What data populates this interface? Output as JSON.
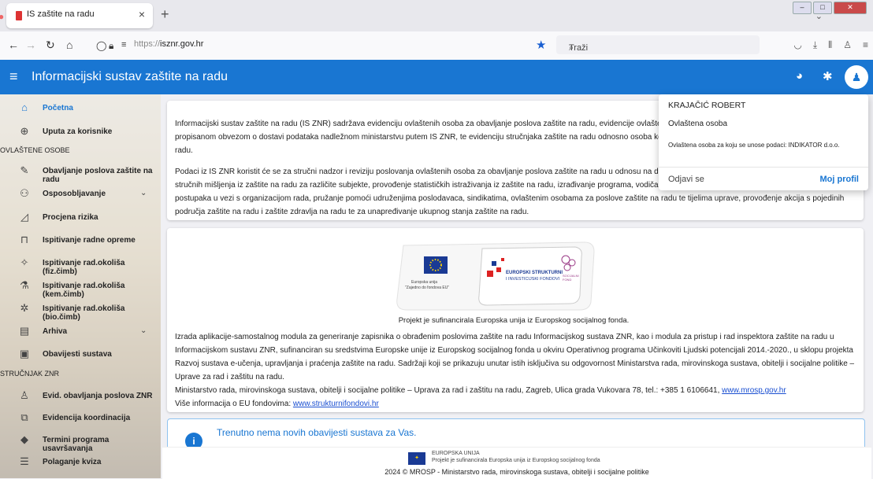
{
  "browser": {
    "tab_title": "IS zaštite na radu",
    "tab_close": "×",
    "new_tab": "+",
    "url_prefix": "https://",
    "url_domain": "isznr.gov.hr",
    "search_placeholder": "Traži"
  },
  "appbar": {
    "title": "Informacijski sustav zaštite na radu"
  },
  "sidebar": {
    "items": [
      {
        "label": "Početna"
      },
      {
        "label": "Uputa za korisnike"
      },
      {
        "label": "Obavljanje poslova zaštite na radu"
      },
      {
        "label": "Osposobljavanje"
      },
      {
        "label": "Procjena rizika"
      },
      {
        "label": "Ispitivanje radne opreme"
      },
      {
        "label": "Ispitivanje rad.okoliša (fiz.čimb)"
      },
      {
        "label": "Ispitivanje rad.okoliša (kem.čimb)"
      },
      {
        "label": "Ispitivanje rad.okoliša (bio.čimb)"
      },
      {
        "label": "Arhiva"
      },
      {
        "label": "Obavijesti sustava"
      },
      {
        "label": "Evid. obavljanja poslova ZNR"
      },
      {
        "label": "Evidencija koordinacija"
      },
      {
        "label": "Termini programa usavršavanja"
      },
      {
        "label": "Polaganje kviza"
      }
    ],
    "section_ovlastene": "OVLAŠTENE OSOBE",
    "section_strucnjak": "STRUČNJAK ZNR"
  },
  "intro": {
    "p1_l1": "Informacijski sustav zaštite na radu (IS ZNR) sadržava evidenciju ovlaštenih osoba za obavljanje poslova zaštite na radu, evidencije ovlašteni",
    "p1_l2": "propisanom obvezom o dostavi podataka nadležnom ministarstvu putem IS ZNR, te evidenciju stručnjaka zaštite na radu odnosno osoba koj",
    "p1_l3": "radu.",
    "p2_l1": "Podaci iz IS ZNR koristit će se za stručni nadzor i reviziju poslovanja ovlaštenih osoba za obavljanje poslova zaštite na radu u odnosu na dob",
    "p2_l2": "stručnih mišljenja iz zaštite na radu za različite subjekte, provođenje statističkih istraživanja iz zaštite na radu, izrađivanje programa, vodiča, r",
    "p2_l3": "postupaka u vezi s organizacijom rada, pružanje pomoći udruženjima poslodavaca, sindikatima, ovlaštenim osobama za poslove zaštite na radu te tijelima uprave, provođenje akcija s pojedinih",
    "p2_l4": "područja zaštite na radu i zaštite zdravlja na radu te za unapređivanje ukupnog stanja zaštite na radu."
  },
  "eu": {
    "logo_eu_l1": "Europska unija",
    "logo_eu_l2": "\"Zajedno do fondova EU\"",
    "logo_fondovi_l1": "EUROPSKI STRUKTURNI",
    "logo_fondovi_l2": "I INVESTICIJSKI FONDOVI",
    "logo_esf": "SOCIJALNI FOND",
    "caption": "Projekt je sufinancirala Europska unija iz Europskog socijalnog fonda.",
    "l1": "Izrada aplikacije-samostalnog modula za generiranje zapisnika o obrađenim poslovima zaštite na radu Informacijskog sustava ZNR, kao i modula za pristup i rad inspektora zaštite na radu u",
    "l2": "Informacijskom sustavu ZNR, sufinanciran su sredstvima Europske unije iz Europskog socijalnog fonda u okviru Operativnog programa Učinkoviti Ljudski potencijali 2014.-2020., u sklopu projekta",
    "l3": "Razvoj sustava e-učenja, upravljanja i praćenja zaštite na radu. Sadržaji koji se prikazuju unutar istih isključiva su odgovornost Ministarstva rada, mirovinskoga sustava, obitelji i socijalne politike –",
    "l4": "Uprave za rad i zaštitu na radu.",
    "l5": "Ministarstvo rada, mirovinskoga sustava, obitelji i socijalne politike – Uprava za rad i zaštitu na radu, Zagreb, Ulica grada Vukovara 78, tel.: +385 1 6106641, ",
    "l5_link": "www.mrosp.gov.hr",
    "l6": "Više informacija o EU fondovima: ",
    "l6_link": "www.strukturnifondovi.hr"
  },
  "notification": {
    "icon": "i",
    "text": "Trenutno nema novih obavijesti sustava za Vas."
  },
  "footer": {
    "eu": "EUROPSKA UNIJA",
    "sub": "Projekt je sufinancirala Europska unija iz Europskog socijalnog fonda",
    "copy": "2024 © MROSP - Ministarstvo rada, mirovinskoga sustava, obitelji i socijalne politike"
  },
  "dropdown": {
    "name": "KRAJAČIĆ ROBERT",
    "role": "Ovlaštena osoba",
    "detail": "Ovlaštena osoba za koju se unose podaci: INDIKATOR d.o.o.",
    "logout": "Odjavi se",
    "profile": "Moj profil"
  },
  "icons": [
    "home-icon",
    "info-icon",
    "edit-icon",
    "people-icon",
    "chart-icon",
    "tool-icon",
    "thermometer-icon",
    "flask-icon",
    "bug-icon",
    "archive-icon",
    "megaphone-icon",
    "user-icon",
    "handshake-icon",
    "school-icon",
    "quiz-icon",
    "palette-icon",
    "bug-icon",
    "account-icon"
  ],
  "colors": {
    "primary": "#1976d2",
    "link": "#1a4fd1"
  }
}
